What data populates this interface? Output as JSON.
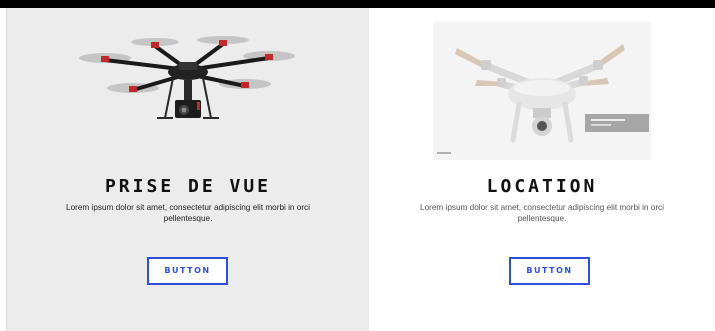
{
  "cards": [
    {
      "title": "PRISE DE VUE",
      "description": "Lorem ipsum dolor sit amet, consectetur adipiscing elit morbi in orci pellentesque.",
      "button_label": "BUTTON",
      "image": "hexacopter-drone-with-camera"
    },
    {
      "title": "LOCATION",
      "description": "Lorem ipsum dolor sit amet, consectetur adipiscing elit morbi in orci pellentesque.",
      "button_label": "BUTTON",
      "image": "white-quadcopter-drone"
    }
  ],
  "colors": {
    "accent": "#2f4fd8",
    "left_panel_bg": "#ececec",
    "right_panel_bg": "#ffffff",
    "top_bar": "#000000"
  }
}
